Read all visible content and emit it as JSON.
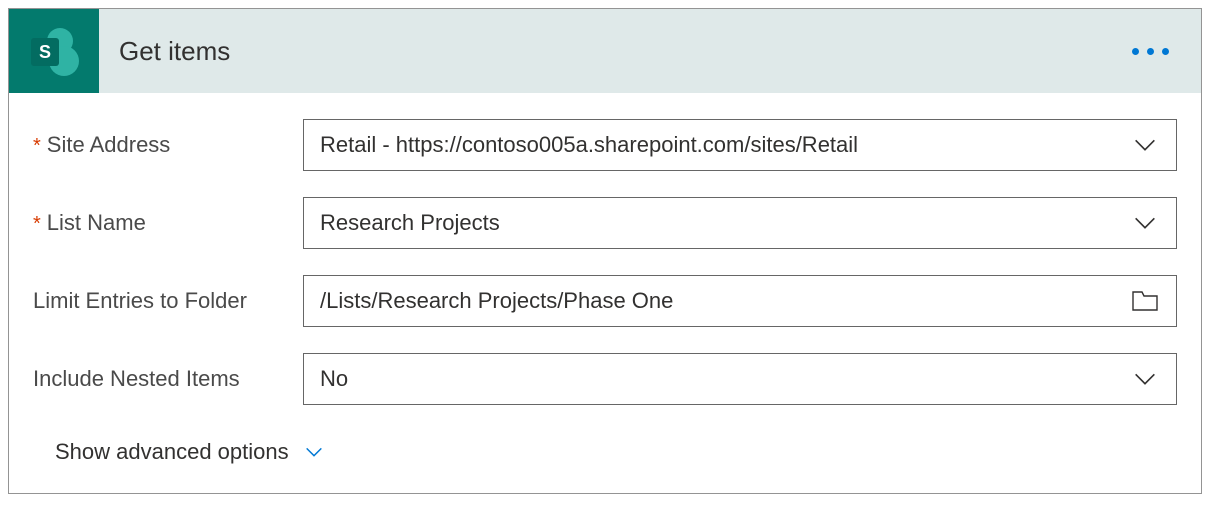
{
  "header": {
    "title": "Get items",
    "icon_letter": "S"
  },
  "fields": {
    "site_address": {
      "label": "Site Address",
      "required": true,
      "value": "Retail - https://contoso005a.sharepoint.com/sites/Retail"
    },
    "list_name": {
      "label": "List Name",
      "required": true,
      "value": "Research Projects"
    },
    "limit_folder": {
      "label": "Limit Entries to Folder",
      "required": false,
      "value": "/Lists/Research Projects/Phase One"
    },
    "include_nested": {
      "label": "Include Nested Items",
      "required": false,
      "value": "No"
    }
  },
  "advanced": {
    "label": "Show advanced options"
  }
}
